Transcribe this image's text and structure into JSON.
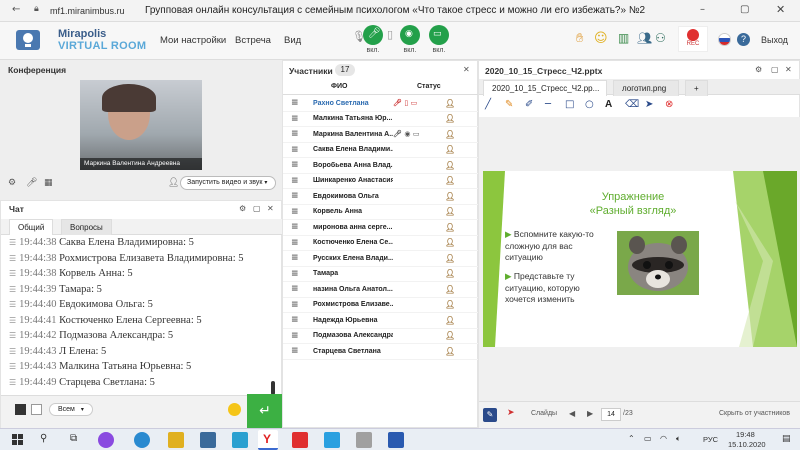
{
  "browser": {
    "url": "mf1.miranimbus.ru",
    "title": "Групповая онлайн консультация с семейным психологом «Что такое стресс и можно ли его избежать?» №2"
  },
  "app": {
    "logo_line1": "Mirapolis",
    "logo_line2": "VIRTUAL ROOM",
    "menu": [
      "Мои настройки",
      "Встреча",
      "Вид"
    ],
    "mic_label": "вкл.",
    "cam_label": "вкл.",
    "screen_label": "вкл.",
    "rec_label": "REC",
    "exit_label": "Выход"
  },
  "conference": {
    "header": "Конференция",
    "video_name": "Маркина Валентина Андреевна",
    "start_video_label": "Запустить видео и звук"
  },
  "chat": {
    "header": "Чат",
    "tabs": [
      "Общий",
      "Вопросы"
    ],
    "messages": [
      {
        "time": "19:44:38",
        "text": "Саква Елена Владимировна: 5"
      },
      {
        "time": "19:44:38",
        "text": "Рохмистрова  Елизавета Владимировна: 5"
      },
      {
        "time": "19:44:38",
        "text": "Корвель Анна: 5"
      },
      {
        "time": "19:44:39",
        "text": "Тамара: 5"
      },
      {
        "time": "19:44:40",
        "text": "Евдокимова Ольга: 5"
      },
      {
        "time": "19:44:41",
        "text": "Костюченко  Елена Сергеевна: 5"
      },
      {
        "time": "19:44:42",
        "text": "Подмазова Александра: 5"
      },
      {
        "time": "19:44:43",
        "text": "Л  Елена: 5"
      },
      {
        "time": "19:44:43",
        "text": "Малкина Татьяна  Юрьевна: 5"
      },
      {
        "time": "19:44:49",
        "text": "Старцева Светлана: 5"
      }
    ],
    "recipient": "Всем"
  },
  "participants": {
    "header": "Участники",
    "count": "17",
    "col_name": "ФИО",
    "col_status": "Статус",
    "rows": [
      "Рахно Светлана",
      "Малкина Татьяна Юр...",
      "Маркина Валентина А...",
      "Саква Елена Владими...",
      "Воробьева Анна Влад...",
      "Шинкаренко Анастасия",
      "Евдокимова Ольга",
      "Корвель Анна",
      "миронова анна серге...",
      "Костюченко Елена Се...",
      "Русских Елена Влади...",
      "Тамара",
      "назина Ольга Анатол...",
      "Рохмистрова Елизаве...",
      "Надежда Юрьевна",
      "Подмазова Александра",
      "Старцева Светлана"
    ]
  },
  "presentation": {
    "header": "2020_10_15_Стресс_Ч2.pptx",
    "tabs": [
      "2020_10_15_Стресс_Ч2.pp...",
      "логотип.png",
      "+"
    ],
    "slide_title_1": "Упражнение",
    "slide_title_2": "«Разный взгляд»",
    "bullet_1": "Вспомните какую-то сложную для вас ситуацию",
    "bullet_2": "Представьте ту ситуацию, которую хочется изменить",
    "slides_label": "Слайды",
    "page_current": "14",
    "page_total": "/23",
    "hide_label": "Скрыть от участников"
  },
  "taskbar": {
    "lang": "РУС",
    "time": "19:48",
    "date": "15.10.2020"
  },
  "colors": {
    "green": "#2ea14d",
    "slide_green": "#8cc63e",
    "title_green": "#5fad2e"
  }
}
